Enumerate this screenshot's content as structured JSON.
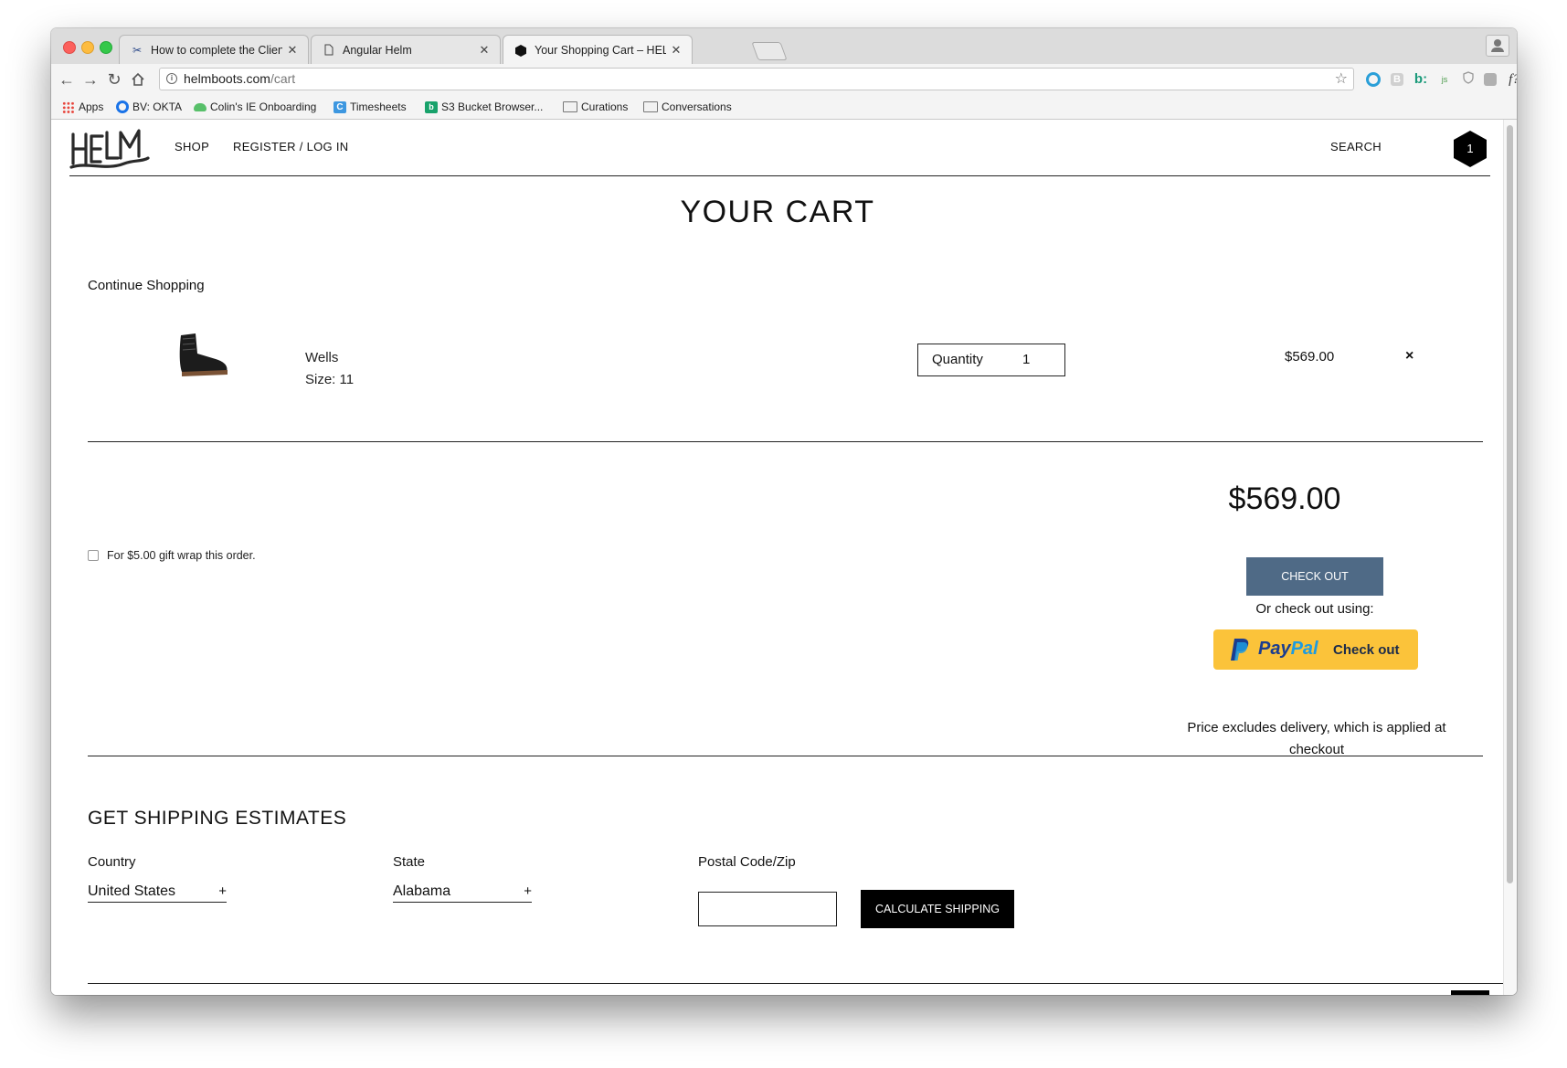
{
  "browser": {
    "tabs": [
      {
        "title": "How to complete the Client pa",
        "icon": "scissors-icon"
      },
      {
        "title": "Angular Helm",
        "icon": "document-icon"
      },
      {
        "title": "Your Shopping Cart – HELM Bo",
        "icon": "hexagon-icon"
      }
    ],
    "url_host": "helmboots.com",
    "url_path": "/cart",
    "bookmarks": [
      {
        "label": "Apps",
        "icon": "apps-grid-icon"
      },
      {
        "label": "BV: OKTA",
        "icon": "okta-icon"
      },
      {
        "label": "Colin's IE Onboarding",
        "icon": "cloud-icon"
      },
      {
        "label": "Timesheets",
        "icon": "timesheets-icon"
      },
      {
        "label": "S3 Bucket Browser...",
        "icon": "bucket-icon"
      },
      {
        "label": "Curations",
        "icon": "folder-icon"
      },
      {
        "label": "Conversations",
        "icon": "folder-icon"
      }
    ],
    "extensions": {
      "b_label": "B",
      "bl_label": "b:",
      "js_label": "js",
      "f_label": "f?"
    }
  },
  "site": {
    "nav": {
      "shop": "SHOP",
      "register": "REGISTER / LOG IN",
      "search": "SEARCH"
    },
    "cart_count": "1"
  },
  "cart": {
    "title": "YOUR CART",
    "continue_label": "Continue Shopping",
    "item": {
      "name": "Wells",
      "size": "Size: 11",
      "quantity_label": "Quantity",
      "quantity": "1",
      "price": "$569.00",
      "remove": "×"
    },
    "gift_wrap_label": "For $5.00 gift wrap this order.",
    "total": "$569.00",
    "checkout_label": "CHECK OUT",
    "or_checkout_label": "Or check out using:",
    "paypal": {
      "pay": "Pay",
      "pal": "Pal",
      "checkout": "Check out"
    },
    "delivery_note": "Price excludes delivery, which is applied at checkout"
  },
  "shipping": {
    "title": "GET SHIPPING ESTIMATES",
    "country_label": "Country",
    "country_value": "United States",
    "state_label": "State",
    "state_value": "Alabama",
    "zip_label": "Postal Code/Zip",
    "zip_value": "",
    "calc_label": "CALCULATE SHIPPING",
    "select_plus": "+"
  },
  "colors": {
    "checkout_button": "#4f6a86",
    "paypal_yellow": "#fbc33a",
    "paypal_dark_blue": "#1b3d8f",
    "paypal_light_blue": "#1e9be0"
  }
}
